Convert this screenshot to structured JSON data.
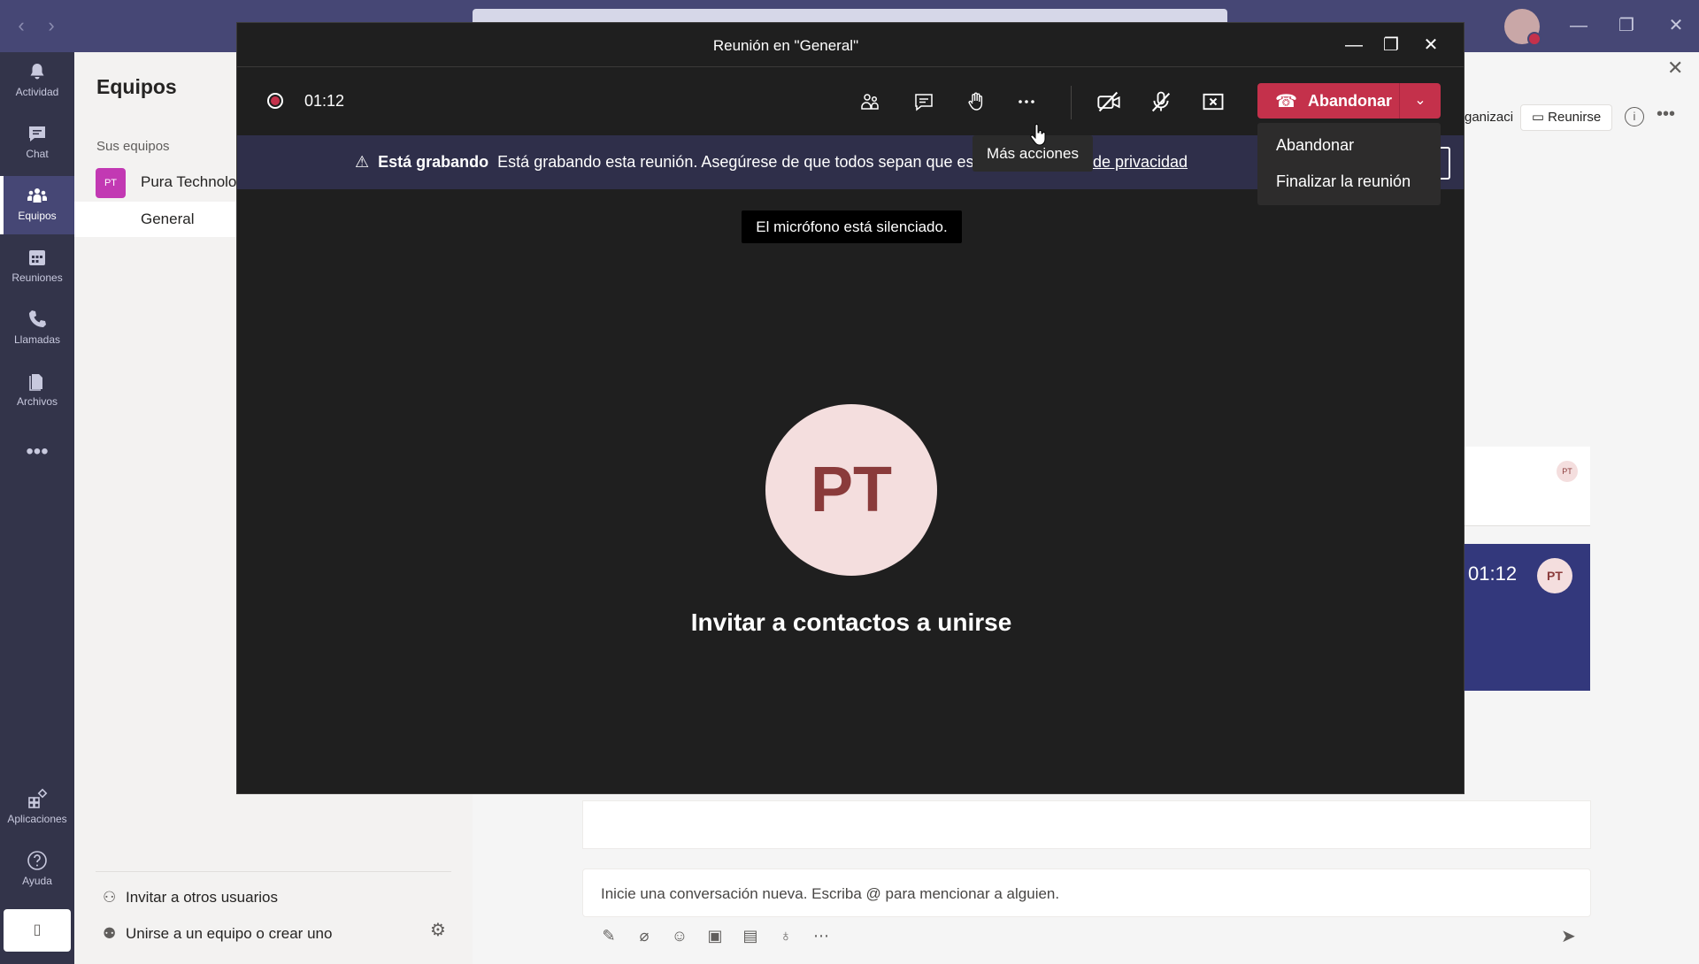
{
  "app_titlebar": {
    "back": "‹",
    "forward": "›",
    "minimize": "—",
    "maximize": "❐",
    "close": "✕"
  },
  "rail": {
    "items": [
      {
        "label": "Actividad",
        "icon": "bell-icon"
      },
      {
        "label": "Chat",
        "icon": "chat-icon"
      },
      {
        "label": "Equipos",
        "icon": "teams-icon"
      },
      {
        "label": "Reuniones",
        "icon": "calendar-icon"
      },
      {
        "label": "Llamadas",
        "icon": "phone-icon"
      },
      {
        "label": "Archivos",
        "icon": "file-icon"
      }
    ],
    "more": "•••",
    "bottom": [
      {
        "label": "Aplicaciones",
        "icon": "apps-icon"
      },
      {
        "label": "Ayuda",
        "icon": "help-icon"
      }
    ],
    "device_icon": "▯"
  },
  "teams_pane": {
    "title": "Equipos",
    "section_label": "Sus equipos",
    "team": {
      "avatar": "PT",
      "name": "Pura Technolo"
    },
    "channel": "General",
    "invite_action": "Invitar a otros usuarios",
    "join_action": "Unirse a un equipo o crear uno"
  },
  "channel": {
    "header_partial": "ganizaci",
    "reunirse": "Reunirse",
    "info": "i",
    "more": "•••",
    "close": "✕",
    "card_avatar": "PT",
    "meeting_time": "01:12",
    "meeting_avatar": "PT",
    "compose_placeholder": "Inicie una conversación nueva. Escriba @ para mencionar a alguien.",
    "tools": [
      "format-icon",
      "attach-icon",
      "emoji-icon",
      "gif-icon",
      "sticker-icon",
      "praise-icon",
      "more-icon"
    ]
  },
  "meeting": {
    "title": "Reunión en \"General\"",
    "window_minimize": "—",
    "window_maximize": "❐",
    "window_close": "✕",
    "elapsed": "01:12",
    "leave_label": "Abandonar",
    "leave_menu": [
      "Abandonar",
      "Finalizar la reunión"
    ],
    "tooltip": "Más acciones",
    "banner": {
      "title": "Está grabando",
      "message": "Está grabando esta reunión. Asegúrese de que todos sepan que está",
      "link": "de privacidad"
    },
    "mute_toast": "El micrófono está silenciado.",
    "avatar": "PT",
    "invite_text": "Invitar a contactos a unirse",
    "colors": {
      "leave": "#c4314b",
      "banner": "#2f2f4a",
      "avatar_bg": "#f4dede",
      "avatar_fg": "#8a3b3b"
    }
  }
}
